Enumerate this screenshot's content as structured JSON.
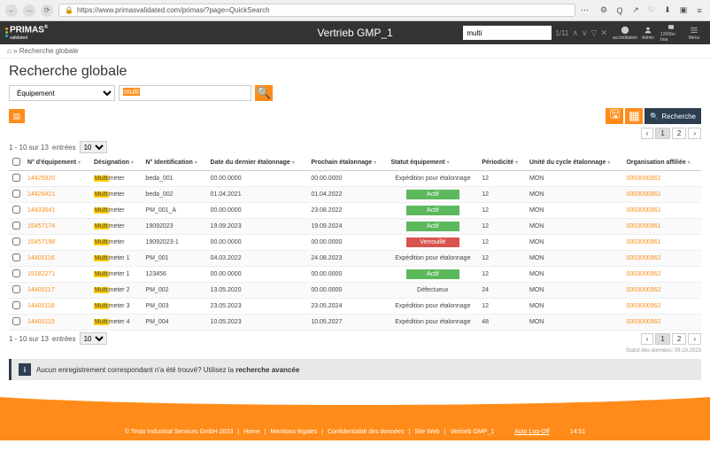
{
  "browser": {
    "url": "https://www.primasvalidated.com/primas/?page=QuickSearch"
  },
  "app": {
    "logo": "PRIMAS",
    "logo_sub": "validated",
    "title": "Vertrieb GMP_1",
    "find_value": "multi",
    "find_count": "1/11"
  },
  "header_icons": [
    {
      "label": "accréditation"
    },
    {
      "label": "Admin"
    },
    {
      "label": "1200bc-boa"
    },
    {
      "label": "Menu"
    }
  ],
  "breadcrumb": {
    "home": "⌂",
    "sep": "»",
    "current": "Recherche globale"
  },
  "page_title": "Recherche globale",
  "filter": {
    "type": "Équipement",
    "query_hl": "multi"
  },
  "toolbar": {
    "search_placeholder": "Recherche"
  },
  "pager": {
    "info": "1 - 10 sur 13",
    "entries_label": "entrées",
    "page_size": "10",
    "pages": [
      "1",
      "2"
    ]
  },
  "columns": [
    "N° d'équipement",
    "Désignation",
    "N° Identification",
    "Date du dernier étalonnage",
    "Prochain étalonnage",
    "Statut équipement",
    "Périodicité",
    "Unité du cycle étalonnage",
    "Organisation affiliée"
  ],
  "rows": [
    {
      "no": "14425920",
      "des": "Multimeter",
      "id": "beda_001",
      "last": "00.00.0000",
      "next": "00.00.0000",
      "status": "Expédition pour étalonnage",
      "badge": "",
      "per": "12",
      "unit": "MON",
      "org": "0003000962"
    },
    {
      "no": "14426421",
      "des": "Multimeter",
      "id": "beda_002",
      "last": "01.04.2021",
      "next": "01.04.2022",
      "status": "Actif",
      "badge": "green",
      "per": "12",
      "unit": "MON",
      "org": "0003000962"
    },
    {
      "no": "14433641",
      "des": "Multimeter",
      "id": "PM_001_A",
      "last": "00.00.0000",
      "next": "23.08.2022",
      "status": "Actif",
      "badge": "green",
      "per": "12",
      "unit": "MON",
      "org": "0003000962"
    },
    {
      "no": "15457174",
      "des": "Multimeter",
      "id": "19092023",
      "last": "19.09.2023",
      "next": "19.09.2024",
      "status": "Actif",
      "badge": "green",
      "per": "12",
      "unit": "MON",
      "org": "0003000961"
    },
    {
      "no": "15457198",
      "des": "Multimeter",
      "id": "19092023-1",
      "last": "00.00.0000",
      "next": "00.00.0000",
      "status": "Verrouillé",
      "badge": "red",
      "per": "12",
      "unit": "MON",
      "org": "0003000961"
    },
    {
      "no": "14400116",
      "des": "Multimeter 1",
      "id": "PM_001",
      "last": "04.03.2022",
      "next": "24.08.2023",
      "status": "Expédition pour étalonnage",
      "badge": "",
      "per": "12",
      "unit": "MON",
      "org": "0003000962"
    },
    {
      "no": "15182271",
      "des": "Multimeter 1",
      "id": "123456",
      "last": "00.00.0000",
      "next": "00.00.0000",
      "status": "Actif",
      "badge": "green",
      "per": "12",
      "unit": "MON",
      "org": "0003000962"
    },
    {
      "no": "14400117",
      "des": "Multimeter 2",
      "id": "PM_002",
      "last": "13.05.2020",
      "next": "00.00.0000",
      "status": "Défectueux",
      "badge": "",
      "per": "24",
      "unit": "MON",
      "org": "0003000962"
    },
    {
      "no": "14400118",
      "des": "Multimeter 3",
      "id": "PM_003",
      "last": "23.05.2023",
      "next": "23.05.2024",
      "status": "Expédition pour étalonnage",
      "badge": "",
      "per": "12",
      "unit": "MON",
      "org": "0003000962"
    },
    {
      "no": "14400119",
      "des": "Multimeter 4",
      "id": "PM_004",
      "last": "10.05.2023",
      "next": "10.05.2027",
      "status": "Expédition pour étalonnage",
      "badge": "",
      "per": "48",
      "unit": "MON",
      "org": "0003000962"
    }
  ],
  "banner": {
    "text_a": "Aucun enregistrement correspondant n'a été trouvé? Utilisez la ",
    "text_b": "recherche avancée"
  },
  "status_date": "Statut des données: 09.10.2023",
  "footer": {
    "copyright": "© Testo Industrial Services GmbH 2023",
    "links": [
      "Home",
      "Mentions légales",
      "Confidentialité des données",
      "Site Web",
      "Vertrieb GMP_1"
    ],
    "auto": "Auto Log-Off",
    "time": "14:51"
  }
}
